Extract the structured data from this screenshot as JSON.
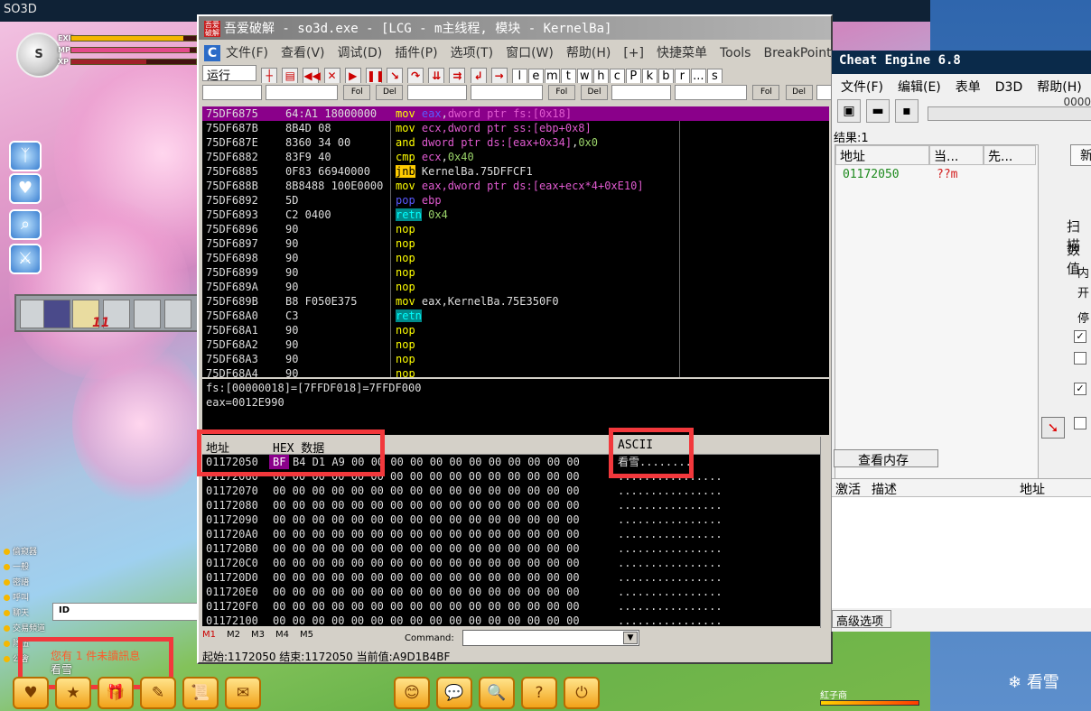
{
  "game": {
    "title": "SO3D",
    "level": "S",
    "stats": [
      {
        "label": "EXP",
        "fill": 0.9,
        "color": "#f3b700"
      },
      {
        "label": "MP",
        "fill": 0.95,
        "color": "#e44a8a"
      },
      {
        "label": "XP",
        "fill": 0.6,
        "color": "#a0202a"
      }
    ],
    "slot_count": "11",
    "chat_channels": [
      "偷窥器",
      "一般",
      "密語",
      "呼叫",
      "聊天",
      "交易頻道",
      "隊伍",
      "公會"
    ],
    "id_label": "ID",
    "chat_msg1": "您有 1 件未讀訊息",
    "chat_msg2": "看雪",
    "bottom_right_label": "紅子商",
    "watermark": "看雪",
    "bottom_icons": [
      "♥",
      "★",
      "🎁",
      "✎",
      "📜",
      "✉",
      "😊",
      "💬",
      "🔍",
      "?",
      "⏻"
    ]
  },
  "od": {
    "title": "吾爱破解 - so3d.exe - [LCG - m主线程, 模块 - KernelBa]",
    "icon_text": "吾爱破解",
    "menu": [
      "文件(F)",
      "查看(V)",
      "调试(D)",
      "插件(P)",
      "选项(T)",
      "窗口(W)",
      "帮助(H)",
      "[+]",
      "快捷菜单",
      "Tools",
      "BreakPoint+"
    ],
    "run_label": "运行",
    "letters": [
      "l",
      "e",
      "m",
      "t",
      "w",
      "h",
      "c",
      "P",
      "k",
      "b",
      "r",
      "...",
      "s"
    ],
    "fol_label": "Fol",
    "del_label": "Del",
    "disasm": [
      {
        "addr": "75DF6875",
        "hex": "64:A1 18000000",
        "ins": [
          [
            "kw",
            "mov "
          ],
          [
            "pp",
            "eax"
          ],
          [
            "",
            ","
          ],
          [
            "rg",
            "dword ptr fs:[0x18]"
          ]
        ],
        "sel": true
      },
      {
        "addr": "75DF687B",
        "hex": "8B4D 08",
        "ins": [
          [
            "kw",
            "mov "
          ],
          [
            "rg",
            "ecx,dword ptr ss:[ebp+0x8]"
          ]
        ]
      },
      {
        "addr": "75DF687E",
        "hex": "8360 34 00",
        "ins": [
          [
            "kw",
            "and "
          ],
          [
            "rg",
            "dword ptr ds:[eax+0x34]"
          ],
          [
            "",
            ","
          ],
          [
            "nm",
            "0x0"
          ]
        ]
      },
      {
        "addr": "75DF6882",
        "hex": "83F9 40",
        "ins": [
          [
            "kw",
            "cmp "
          ],
          [
            "rg",
            "ecx"
          ],
          [
            "",
            ","
          ],
          [
            "nm",
            "0x40"
          ]
        ]
      },
      {
        "addr": "75DF6885",
        "hex": "0F83 66940000",
        "ins": [
          [
            "kj",
            "jnb"
          ],
          [
            "",
            " KernelBa.75DFFCF1"
          ]
        ]
      },
      {
        "addr": "75DF688B",
        "hex": "8B8488 100E0000",
        "ins": [
          [
            "kw",
            "mov "
          ],
          [
            "rg",
            "eax,dword ptr ds:[eax+ecx*4+0xE10]"
          ]
        ]
      },
      {
        "addr": "75DF6892",
        "hex": "5D",
        "ins": [
          [
            "pp",
            "pop "
          ],
          [
            "rg",
            "ebp"
          ]
        ]
      },
      {
        "addr": "75DF6893",
        "hex": "C2 0400",
        "ins": [
          [
            "kc",
            "retn"
          ],
          [
            "nm",
            " 0x4"
          ]
        ]
      },
      {
        "addr": "75DF6896",
        "hex": "90",
        "ins": [
          [
            "kw",
            "nop"
          ]
        ]
      },
      {
        "addr": "75DF6897",
        "hex": "90",
        "ins": [
          [
            "kw",
            "nop"
          ]
        ]
      },
      {
        "addr": "75DF6898",
        "hex": "90",
        "ins": [
          [
            "kw",
            "nop"
          ]
        ]
      },
      {
        "addr": "75DF6899",
        "hex": "90",
        "ins": [
          [
            "kw",
            "nop"
          ]
        ]
      },
      {
        "addr": "75DF689A",
        "hex": "90",
        "ins": [
          [
            "kw",
            "nop"
          ]
        ]
      },
      {
        "addr": "75DF689B",
        "hex": "B8 F050E375",
        "ins": [
          [
            "kw",
            "mov "
          ],
          [
            "",
            "eax,KernelBa.75E350F0"
          ]
        ]
      },
      {
        "addr": "75DF68A0",
        "hex": "C3",
        "ins": [
          [
            "kc",
            "retn"
          ]
        ]
      },
      {
        "addr": "75DF68A1",
        "hex": "90",
        "ins": [
          [
            "kw",
            "nop"
          ]
        ]
      },
      {
        "addr": "75DF68A2",
        "hex": "90",
        "ins": [
          [
            "kw",
            "nop"
          ]
        ]
      },
      {
        "addr": "75DF68A3",
        "hex": "90",
        "ins": [
          [
            "kw",
            "nop"
          ]
        ]
      },
      {
        "addr": "75DF68A4",
        "hex": "90",
        "ins": [
          [
            "kw",
            "nop"
          ]
        ]
      }
    ],
    "info": [
      "fs:[00000018]=[7FFDF018]=7FFDF000",
      "eax=0012E990"
    ],
    "hex_header": {
      "addr": "地址",
      "hex": "HEX 数据",
      "ascii": "ASCII"
    },
    "hex_rows": [
      {
        "addr": "01172050",
        "bytes": "BF B4 D1 A9 00 00 00 00 00 00 00 00 00 00 00 00",
        "ascii": "看雪........",
        "hl": "BF"
      },
      {
        "addr": "01172060",
        "bytes": "00 00 00 00 00 00 00 00 00 00 00 00 00 00 00 00",
        "ascii": "................"
      },
      {
        "addr": "01172070",
        "bytes": "00 00 00 00 00 00 00 00 00 00 00 00 00 00 00 00",
        "ascii": "................"
      },
      {
        "addr": "01172080",
        "bytes": "00 00 00 00 00 00 00 00 00 00 00 00 00 00 00 00",
        "ascii": "................"
      },
      {
        "addr": "01172090",
        "bytes": "00 00 00 00 00 00 00 00 00 00 00 00 00 00 00 00",
        "ascii": "................"
      },
      {
        "addr": "011720A0",
        "bytes": "00 00 00 00 00 00 00 00 00 00 00 00 00 00 00 00",
        "ascii": "................"
      },
      {
        "addr": "011720B0",
        "bytes": "00 00 00 00 00 00 00 00 00 00 00 00 00 00 00 00",
        "ascii": "................"
      },
      {
        "addr": "011720C0",
        "bytes": "00 00 00 00 00 00 00 00 00 00 00 00 00 00 00 00",
        "ascii": "................"
      },
      {
        "addr": "011720D0",
        "bytes": "00 00 00 00 00 00 00 00 00 00 00 00 00 00 00 00",
        "ascii": "................"
      },
      {
        "addr": "011720E0",
        "bytes": "00 00 00 00 00 00 00 00 00 00 00 00 00 00 00 00",
        "ascii": "................"
      },
      {
        "addr": "011720F0",
        "bytes": "00 00 00 00 00 00 00 00 00 00 00 00 00 00 00 00",
        "ascii": "................"
      },
      {
        "addr": "01172100",
        "bytes": "00 00 00 00 00 00 00 00 00 00 00 00 00 00 00 00",
        "ascii": "................"
      }
    ],
    "mem_tabs": [
      "M1",
      "M2",
      "M3",
      "M4",
      "M5"
    ],
    "command_label": "Command:",
    "status": "起始:1172050 结束:1172050 当前值:A9D1B4BF"
  },
  "ce": {
    "title": "Cheat Engine 6.8",
    "menu": [
      "文件(F)",
      "编辑(E)",
      "表单",
      "D3D",
      "帮助(H)"
    ],
    "addr_count": "0000",
    "results": "结果:1",
    "list_headers": [
      "地址",
      "当...",
      "先..."
    ],
    "list_rows": [
      {
        "addr": "01172050",
        "val": "??m"
      }
    ],
    "new_btn": "新",
    "scan_label": "扫描",
    "value_label": "数值",
    "side_labels": [
      "内",
      "开",
      "停"
    ],
    "mem_view_btn": "查看内存",
    "table_headers": [
      "激活",
      "描述",
      "地址"
    ],
    "advanced_btn": "高级选项"
  }
}
